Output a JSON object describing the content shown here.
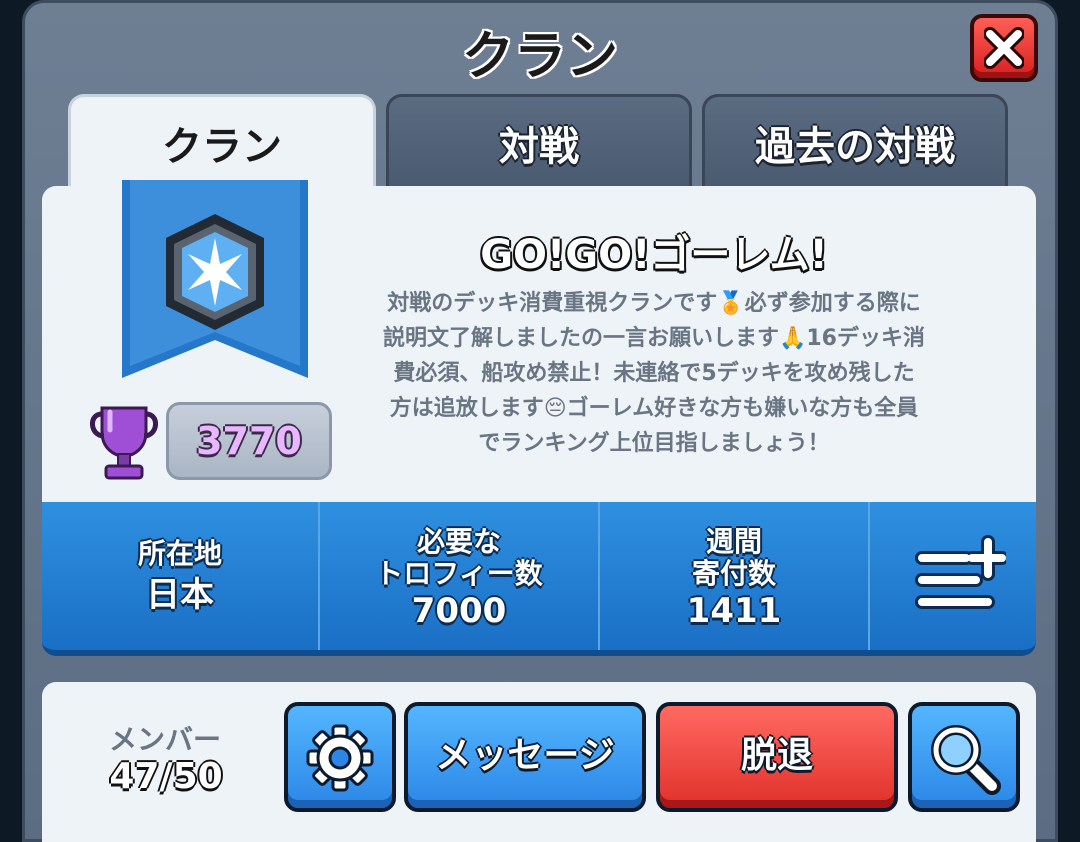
{
  "header": {
    "title": "クラン",
    "close_icon": "close-icon"
  },
  "tabs": [
    {
      "label": "クラン",
      "active": true
    },
    {
      "label": "対戦",
      "active": false
    },
    {
      "label": "過去の対戦",
      "active": false
    }
  ],
  "clan": {
    "badge_icon": "clan-badge-icon",
    "trophy_icon": "trophy-icon",
    "trophies": "3770",
    "name": "GO!GO!ゴーレム!",
    "description_lines": [
      "対戦のデッキ消費重視クランです🏅必ず参加する際に",
      "説明文了解しましたの一言お願いします🙏16デッキ消",
      "費必須、船攻め禁止！未連絡で5デッキを攻め残した",
      "方は追放します😔ゴーレム好きな方も嫌いな方も全員",
      "でランキング上位目指しましょう！"
    ]
  },
  "stats": {
    "location": {
      "label": "所在地",
      "value": "日本"
    },
    "required_trophies": {
      "label_line1": "必要な",
      "label_line2": "トロフィー数",
      "value": "7000"
    },
    "weekly_donations": {
      "label_line1": "週間",
      "label_line2": "寄付数",
      "value": "1411"
    },
    "more_icon": "list-add-icon"
  },
  "members": {
    "label": "メンバー",
    "count": "47/50"
  },
  "buttons": {
    "settings_icon": "gear-icon",
    "message": "メッセージ",
    "leave": "脱退",
    "search_icon": "search-icon"
  },
  "colors": {
    "accent_blue": "#2b86e6",
    "danger_red": "#e0302a",
    "trophy_purple": "#e8b7ff"
  }
}
